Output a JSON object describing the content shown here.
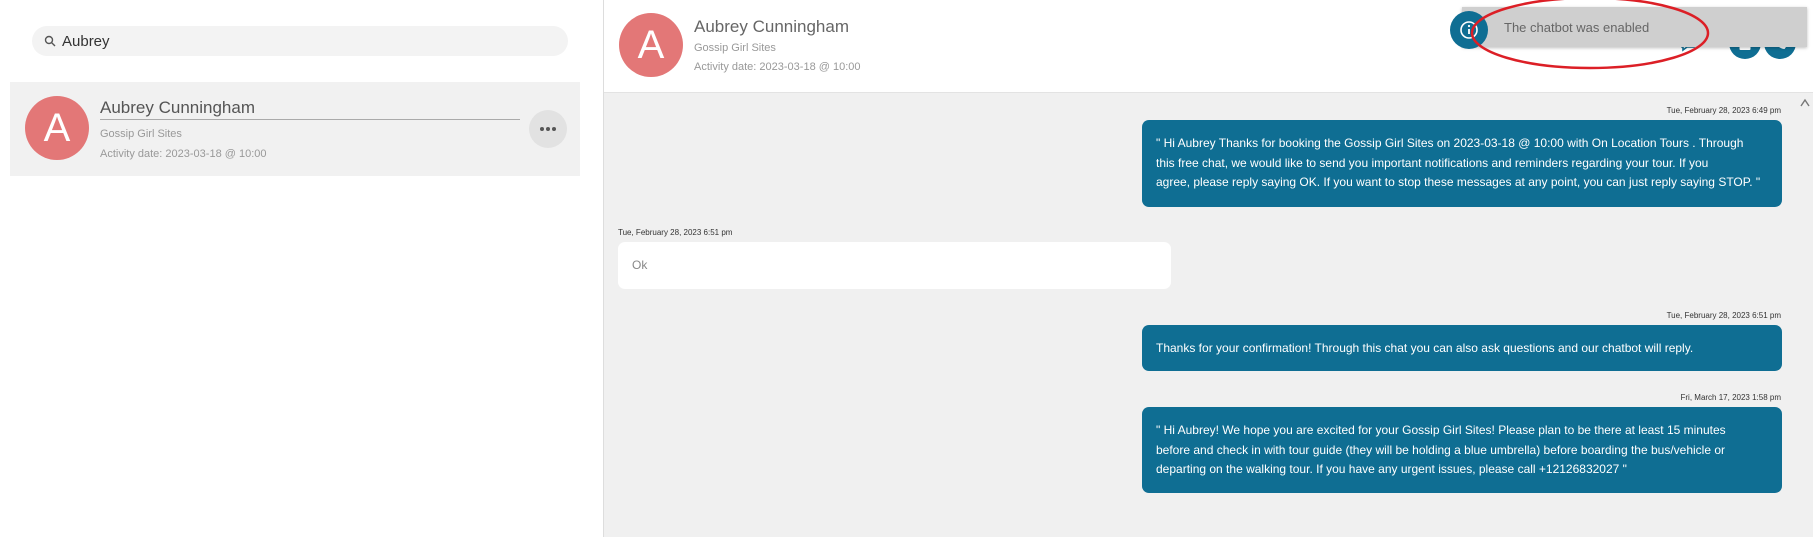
{
  "search": {
    "value": "Aubrey"
  },
  "contact": {
    "initial": "A",
    "name": "Aubrey Cunningham",
    "tour": "Gossip Girl Sites",
    "activity": "Activity date: 2023-03-18 @ 10:00"
  },
  "header": {
    "initial": "A",
    "name": "Aubrey Cunningham",
    "tour": "Gossip Girl Sites",
    "activity": "Activity date: 2023-03-18 @ 10:00"
  },
  "toast": {
    "text": "The chatbot was enabled"
  },
  "messages": [
    {
      "direction": "out",
      "timestamp": "Tue, February 28, 2023 6:49 pm",
      "lines": [
        "\" Hi Aubrey Thanks for booking the Gossip Girl Sites on 2023-03-18 @ 10:00 with On Location Tours . Through",
        "this free chat, we would like to send you important notifications and reminders regarding your tour. If you",
        "agree, please reply saying OK. If you want to stop these messages at any point, you can just reply saying STOP. \""
      ]
    },
    {
      "direction": "in",
      "timestamp": "Tue, February 28, 2023 6:51 pm",
      "lines": [
        "Ok"
      ]
    },
    {
      "direction": "out",
      "timestamp": "Tue, February 28, 2023 6:51 pm",
      "lines": [
        "Thanks for your confirmation! Through this chat you can also ask questions and our chatbot will reply."
      ]
    },
    {
      "direction": "out",
      "timestamp": "Fri, March 17, 2023 1:58 pm",
      "lines": [
        "\" Hi Aubrey! We hope you are excited for your Gossip Girl Sites! Please plan to be there at least 15 minutes",
        "before and check in with tour guide (they will be holding a blue umbrella) before boarding the bus/vehicle or",
        "departing on the walking tour. If you have any urgent issues, please call +12126832027 \""
      ]
    }
  ],
  "icons": {
    "search": "search-icon",
    "more": "more-icon",
    "toast": "info-icon",
    "header_actions": [
      "chat-icon",
      "clipboard-icon",
      "phone-icon"
    ]
  },
  "colors": {
    "accent": "#0f6e93",
    "avatar": "#e37777",
    "highlight": "#dc1f26"
  }
}
